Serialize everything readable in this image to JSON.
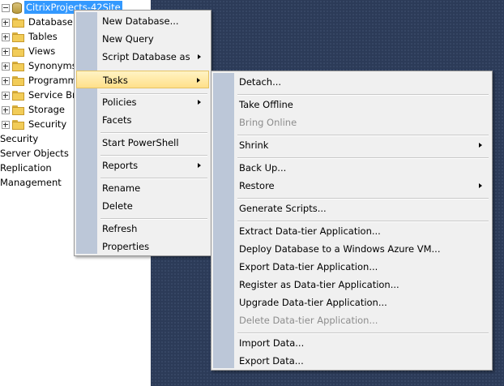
{
  "explorer": {
    "root_label": "CitrixProjects-42Site",
    "children": [
      {
        "label": "Database D"
      },
      {
        "label": "Tables"
      },
      {
        "label": "Views"
      },
      {
        "label": "Synonyms"
      },
      {
        "label": "Programm"
      },
      {
        "label": "Service Bro"
      },
      {
        "label": "Storage"
      },
      {
        "label": "Security"
      }
    ],
    "server_items": [
      {
        "label": "Security"
      },
      {
        "label": "Server Objects"
      },
      {
        "label": "Replication"
      },
      {
        "label": "Management"
      }
    ]
  },
  "context_menu": {
    "items": [
      {
        "label": "New Database..."
      },
      {
        "label": "New Query"
      },
      {
        "label": "Script Database as"
      },
      {
        "label": "Tasks"
      },
      {
        "label": "Policies"
      },
      {
        "label": "Facets"
      },
      {
        "label": "Start PowerShell"
      },
      {
        "label": "Reports"
      },
      {
        "label": "Rename"
      },
      {
        "label": "Delete"
      },
      {
        "label": "Refresh"
      },
      {
        "label": "Properties"
      }
    ]
  },
  "tasks_menu": {
    "items": [
      {
        "label": "Detach..."
      },
      {
        "label": "Take Offline"
      },
      {
        "label": "Bring Online"
      },
      {
        "label": "Shrink"
      },
      {
        "label": "Back Up..."
      },
      {
        "label": "Restore"
      },
      {
        "label": "Generate Scripts..."
      },
      {
        "label": "Extract Data-tier Application..."
      },
      {
        "label": "Deploy Database to a Windows Azure VM..."
      },
      {
        "label": "Export Data-tier Application..."
      },
      {
        "label": "Register as Data-tier Application..."
      },
      {
        "label": "Upgrade Data-tier Application..."
      },
      {
        "label": "Delete Data-tier Application..."
      },
      {
        "label": "Import Data..."
      },
      {
        "label": "Export Data..."
      }
    ]
  },
  "colors": {
    "selection": "#3399ff",
    "highlight": "#ffe08a",
    "workspace": "#2c3b58"
  }
}
